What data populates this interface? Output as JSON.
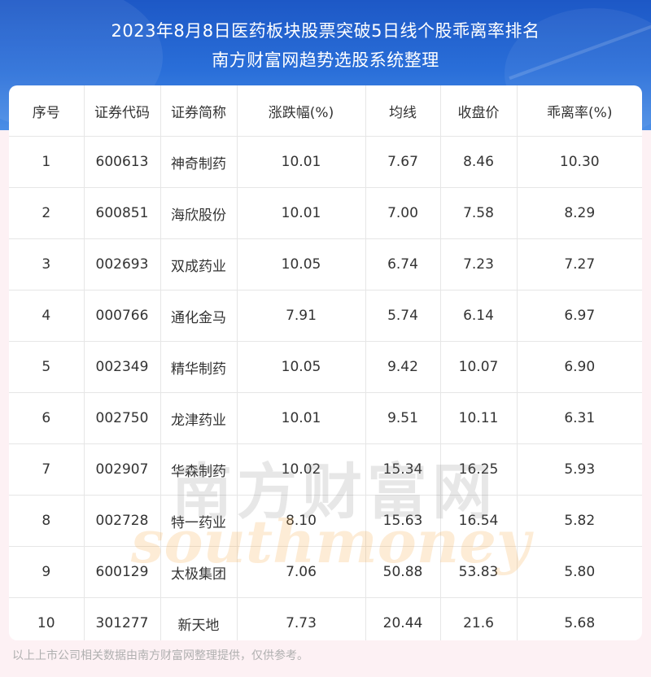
{
  "header": {
    "title_line1": "2023年8月8日医药板块股票突破5日线个股乖离率排名",
    "title_line2": "南方财富网趋势选股系统整理"
  },
  "table": {
    "columns": [
      "序号",
      "证券代码",
      "证券简称",
      "涨跌幅(%)",
      "均线",
      "收盘价",
      "乖离率(%)"
    ],
    "rows": [
      [
        "1",
        "600613",
        "神奇制药",
        "10.01",
        "7.67",
        "8.46",
        "10.30"
      ],
      [
        "2",
        "600851",
        "海欣股份",
        "10.01",
        "7.00",
        "7.58",
        "8.29"
      ],
      [
        "3",
        "002693",
        "双成药业",
        "10.05",
        "6.74",
        "7.23",
        "7.27"
      ],
      [
        "4",
        "000766",
        "通化金马",
        "7.91",
        "5.74",
        "6.14",
        "6.97"
      ],
      [
        "5",
        "002349",
        "精华制药",
        "10.05",
        "9.42",
        "10.07",
        "6.90"
      ],
      [
        "6",
        "002750",
        "龙津药业",
        "10.01",
        "9.51",
        "10.11",
        "6.31"
      ],
      [
        "7",
        "002907",
        "华森制药",
        "10.02",
        "15.34",
        "16.25",
        "5.93"
      ],
      [
        "8",
        "002728",
        "特一药业",
        "8.10",
        "15.63",
        "16.54",
        "5.82"
      ],
      [
        "9",
        "600129",
        "太极集团",
        "7.06",
        "50.88",
        "53.83",
        "5.80"
      ],
      [
        "10",
        "301277",
        "新天地",
        "7.73",
        "20.44",
        "21.6",
        "5.68"
      ]
    ]
  },
  "watermark": {
    "cn": "南方财富网",
    "en": "southmoney"
  },
  "footer": {
    "note": "以上上市公司相关数据由南方财富网整理提供，仅供参考。"
  },
  "colors": {
    "banner": "#2a6fd9",
    "background": "#fdf1f4",
    "text": "#333333",
    "grid": "#e6e6e6"
  }
}
